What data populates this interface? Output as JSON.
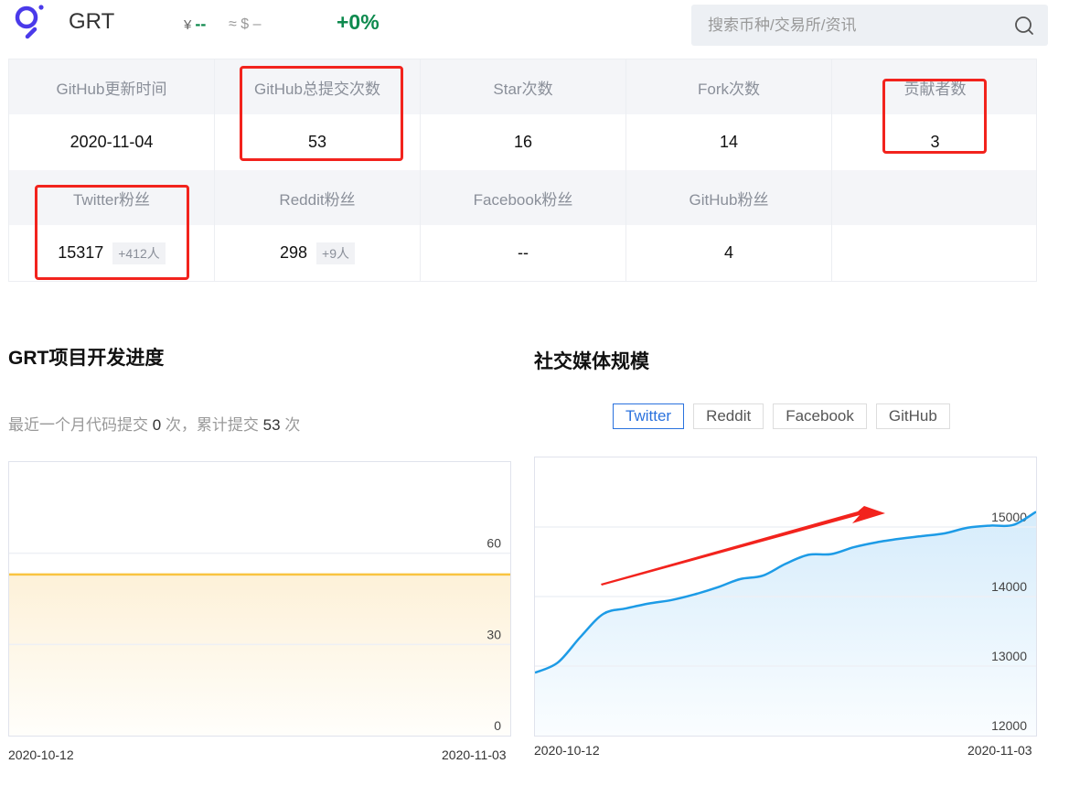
{
  "header": {
    "coin": "GRT",
    "cny_symbol": "¥",
    "cny_price": "--",
    "usd_approx": "≈ $ –",
    "change": "+0%",
    "search_placeholder": "搜索币种/交易所/资讯",
    "logo_icon": "graph-logo-icon",
    "search_icon": "search-icon"
  },
  "stats": {
    "row1_headers": [
      "GitHub更新时间",
      "GitHub总提交次数",
      "Star次数",
      "Fork次数",
      "贡献者数"
    ],
    "row1_values": [
      "2020-11-04",
      "53",
      "16",
      "14",
      "3"
    ],
    "row2_headers": [
      "Twitter粉丝",
      "Reddit粉丝",
      "Facebook粉丝",
      "GitHub粉丝",
      ""
    ],
    "row2_values": [
      "15317",
      "298",
      "--",
      "4",
      ""
    ],
    "row2_deltas": [
      "+412人",
      "+9人",
      "",
      "",
      ""
    ]
  },
  "dev": {
    "title": "GRT项目开发进度",
    "summary_prefix": "最近一个月代码提交",
    "recent_commits": "0",
    "unit1": "次，累计提交",
    "total_commits": "53",
    "unit2": "次"
  },
  "social": {
    "title": "社交媒体规模",
    "tabs": [
      "Twitter",
      "Reddit",
      "Facebook",
      "GitHub"
    ],
    "active_tab": "Twitter"
  },
  "colors": {
    "up_green": "#0e8a4e",
    "accent_blue": "#2a72de",
    "dev_line": "#f9c440",
    "social_line": "#1d9be6",
    "annotation_red": "#f2231d"
  },
  "chart_data": [
    {
      "type": "area",
      "title": "GRT项目开发进度",
      "series": [
        {
          "name": "累计提交",
          "x": [
            "2020-10-12",
            "2020-11-03"
          ],
          "values": [
            53,
            53
          ]
        }
      ],
      "x_tick_labels": [
        "2020-10-12",
        "2020-11-03"
      ],
      "y_ticks": [
        0,
        30,
        60
      ],
      "ylim": [
        0,
        90
      ],
      "grid": true
    },
    {
      "type": "area",
      "title": "社交媒体规模 - Twitter",
      "series": [
        {
          "name": "Twitter",
          "x": [
            "2020-10-12",
            "2020-10-13",
            "2020-10-14",
            "2020-10-15",
            "2020-10-16",
            "2020-10-17",
            "2020-10-18",
            "2020-10-19",
            "2020-10-20",
            "2020-10-21",
            "2020-10-22",
            "2020-10-23",
            "2020-10-24",
            "2020-10-25",
            "2020-10-26",
            "2020-10-27",
            "2020-10-28",
            "2020-10-29",
            "2020-10-30",
            "2020-10-31",
            "2020-11-01",
            "2020-11-02",
            "2020-11-03"
          ],
          "values": [
            12905,
            13050,
            13420,
            13750,
            13830,
            13900,
            13950,
            14030,
            14130,
            14250,
            14300,
            14470,
            14600,
            14610,
            14710,
            14780,
            14830,
            14870,
            14910,
            14990,
            15020,
            15030,
            15220
          ]
        }
      ],
      "x_tick_labels": [
        "2020-10-12",
        "2020-11-03"
      ],
      "y_ticks": [
        12000,
        13000,
        14000,
        15000
      ],
      "ylim": [
        12000,
        16000
      ],
      "grid": true
    }
  ]
}
